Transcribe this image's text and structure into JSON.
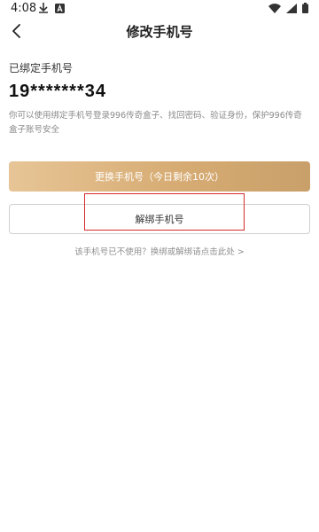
{
  "status_bar": {
    "time": "4:08",
    "left_icons": [
      "download-icon",
      "a-badge-icon"
    ],
    "right_icons": [
      "wifi-icon",
      "signal-icon",
      "battery-icon"
    ]
  },
  "header": {
    "back_icon": "chevron-left-icon",
    "title": "修改手机号"
  },
  "content": {
    "bound_label": "已绑定手机号",
    "phone_number": "19*******34",
    "description": "你可以使用绑定手机号登录996传奇盒子、找回密码、验证身份，保护996传奇盒子账号安全"
  },
  "actions": {
    "change_label": "更换手机号（今日剩余10次）",
    "unbind_label": "解绑手机号",
    "help_link": "该手机号已不使用？换绑或解绑请点击此处 >"
  },
  "colors": {
    "accent_gold": "#d7ac74",
    "highlight_red": "#d62a2a"
  }
}
